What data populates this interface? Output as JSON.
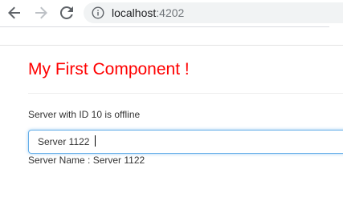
{
  "browser": {
    "url_host": "localhost",
    "url_port": ":4202",
    "icons": {
      "back": "arrow-left-icon",
      "forward": "arrow-right-icon",
      "reload": "reload-icon",
      "info": "info-icon"
    }
  },
  "page": {
    "title": "My First Component !",
    "title_color": "#ff0000",
    "server_status": "Server with ID 10 is offline",
    "server_name_input": {
      "value": "Server 1122"
    },
    "server_name_label": "Server Name : ",
    "server_name_value": "Server 1122"
  }
}
